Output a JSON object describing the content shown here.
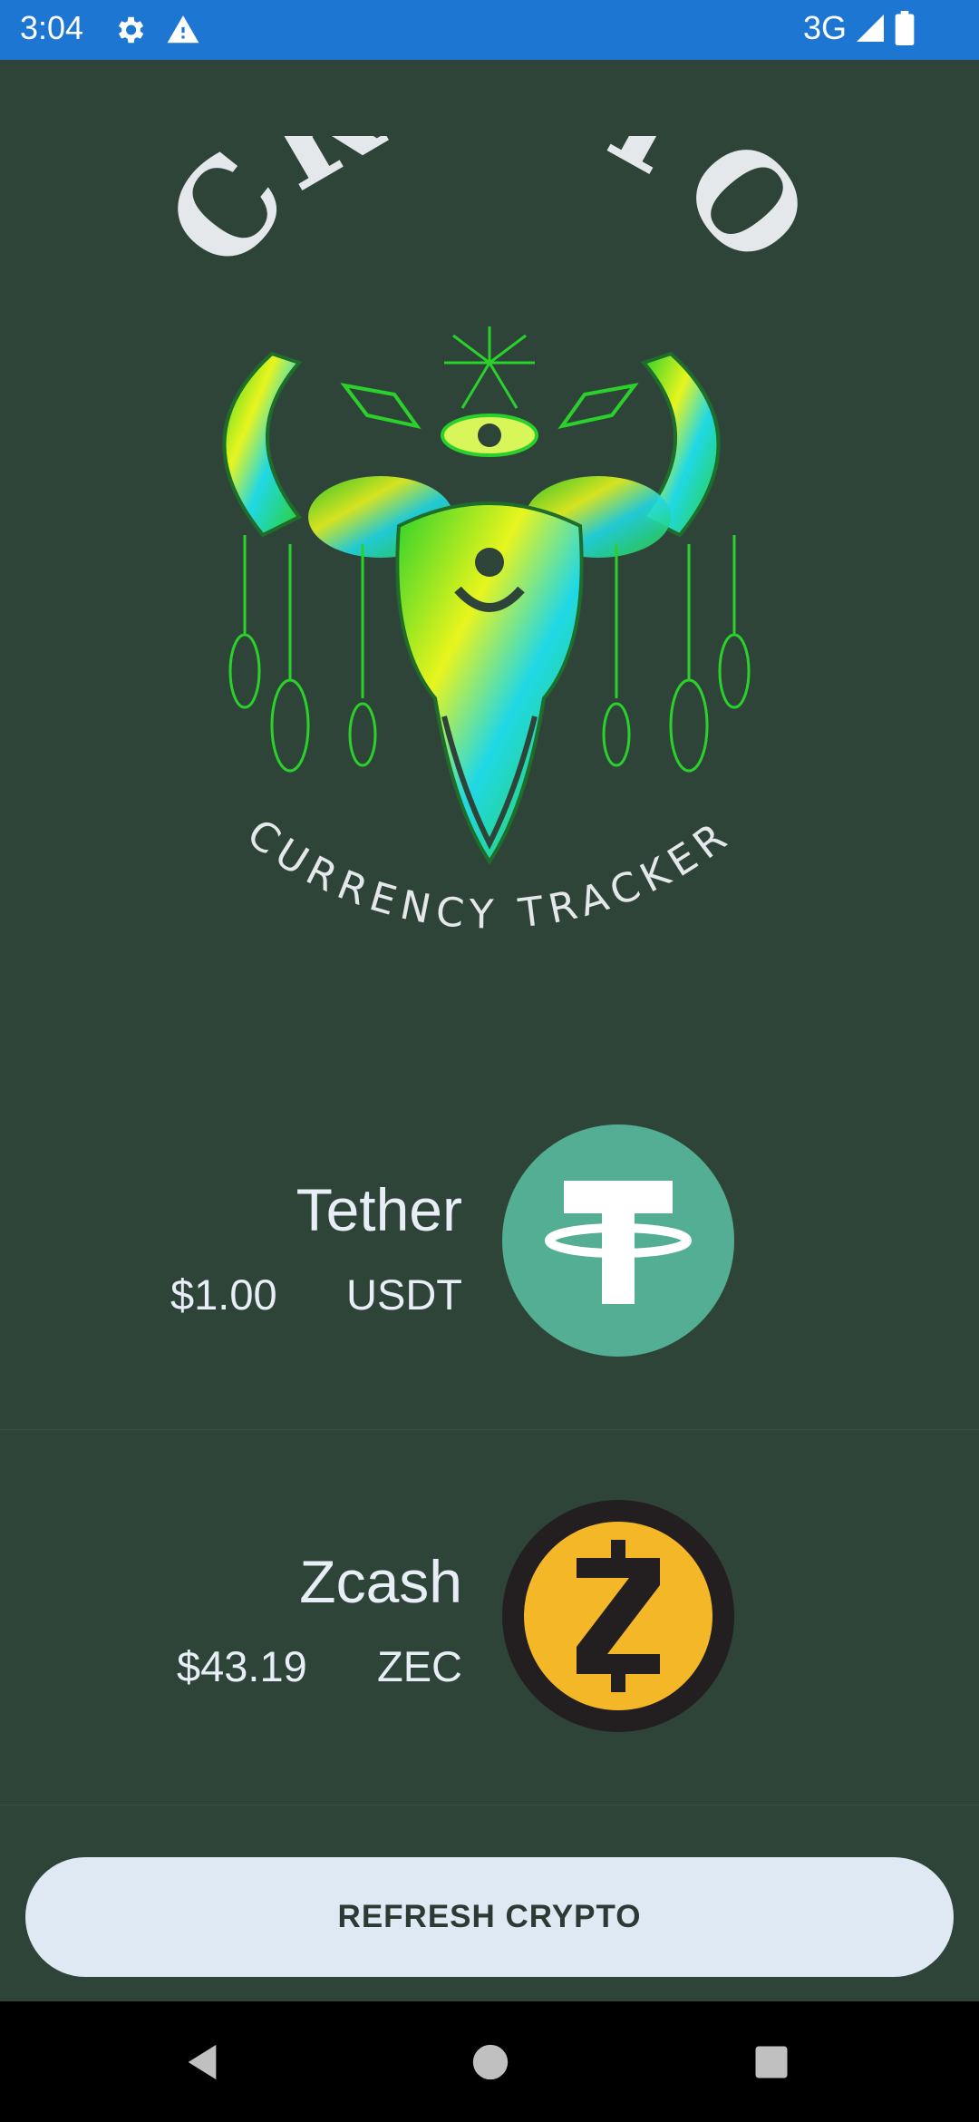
{
  "status_bar": {
    "time": "3:04",
    "network": "3G",
    "icons": [
      "gear-icon",
      "warning-icon",
      "signal-icon",
      "battery-icon"
    ]
  },
  "logo": {
    "title_text": "CRYPTO",
    "subtitle_text": "CURRENCY TRACKER"
  },
  "coins": [
    {
      "name": "Tether",
      "price": "$1.00",
      "symbol": "USDT",
      "icon": "tether-icon",
      "color": "#53ae94"
    },
    {
      "name": "Zcash",
      "price": "$43.19",
      "symbol": "ZEC",
      "icon": "zcash-icon",
      "color": "#f4b728"
    }
  ],
  "refresh_button": {
    "label": "REFRESH CRYPTO"
  },
  "nav": {
    "icons": [
      "back-icon",
      "home-icon",
      "recents-icon"
    ]
  },
  "colors": {
    "background": "#2f4439",
    "status_bar": "#1c76d2",
    "button": "#dfe9f3",
    "text": "#e7eef5"
  }
}
